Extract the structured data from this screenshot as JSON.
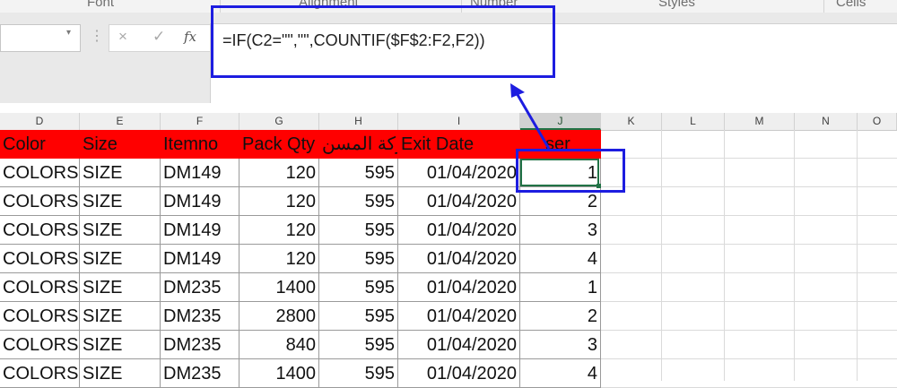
{
  "ribbon": {
    "groups": [
      "Font",
      "Alignment",
      "Number",
      "Styles",
      "Cells"
    ]
  },
  "formula_bar": {
    "name_box": "",
    "cancel_icon": "×",
    "enter_icon": "✓",
    "fx_label": "fx",
    "formula": "=IF(C2=\"\",\"\",COUNTIF($F$2:F2,F2))"
  },
  "columns": [
    "D",
    "E",
    "F",
    "G",
    "H",
    "I",
    "J",
    "K",
    "L",
    "M",
    "N",
    "O"
  ],
  "selected_column": "J",
  "table": {
    "headers": [
      "Color",
      "Size",
      "Itemno",
      "Pack Qty",
      "حركة المسن",
      "Exit Date",
      "ser"
    ],
    "rows": [
      [
        "COLORS",
        "SIZE",
        "DM149",
        "120",
        "595",
        "01/04/2020",
        "1"
      ],
      [
        "COLORS",
        "SIZE",
        "DM149",
        "120",
        "595",
        "01/04/2020",
        "2"
      ],
      [
        "COLORS",
        "SIZE",
        "DM149",
        "120",
        "595",
        "01/04/2020",
        "3"
      ],
      [
        "COLORS",
        "SIZE",
        "DM149",
        "120",
        "595",
        "01/04/2020",
        "4"
      ],
      [
        "COLORS",
        "SIZE",
        "DM235",
        "1400",
        "595",
        "01/04/2020",
        "1"
      ],
      [
        "COLORS",
        "SIZE",
        "DM235",
        "2800",
        "595",
        "01/04/2020",
        "2"
      ],
      [
        "COLORS",
        "SIZE",
        "DM235",
        "840",
        "595",
        "01/04/2020",
        "3"
      ],
      [
        "COLORS",
        "SIZE",
        "DM235",
        "1400",
        "595",
        "01/04/2020",
        "4"
      ]
    ]
  },
  "colors": {
    "header_fill": "#ff0000",
    "annotation": "#1d1de0",
    "selection": "#217346"
  },
  "icons": [
    "dropdown-icon",
    "cancel-icon",
    "enter-icon",
    "function-icon",
    "arrow-annotation"
  ]
}
